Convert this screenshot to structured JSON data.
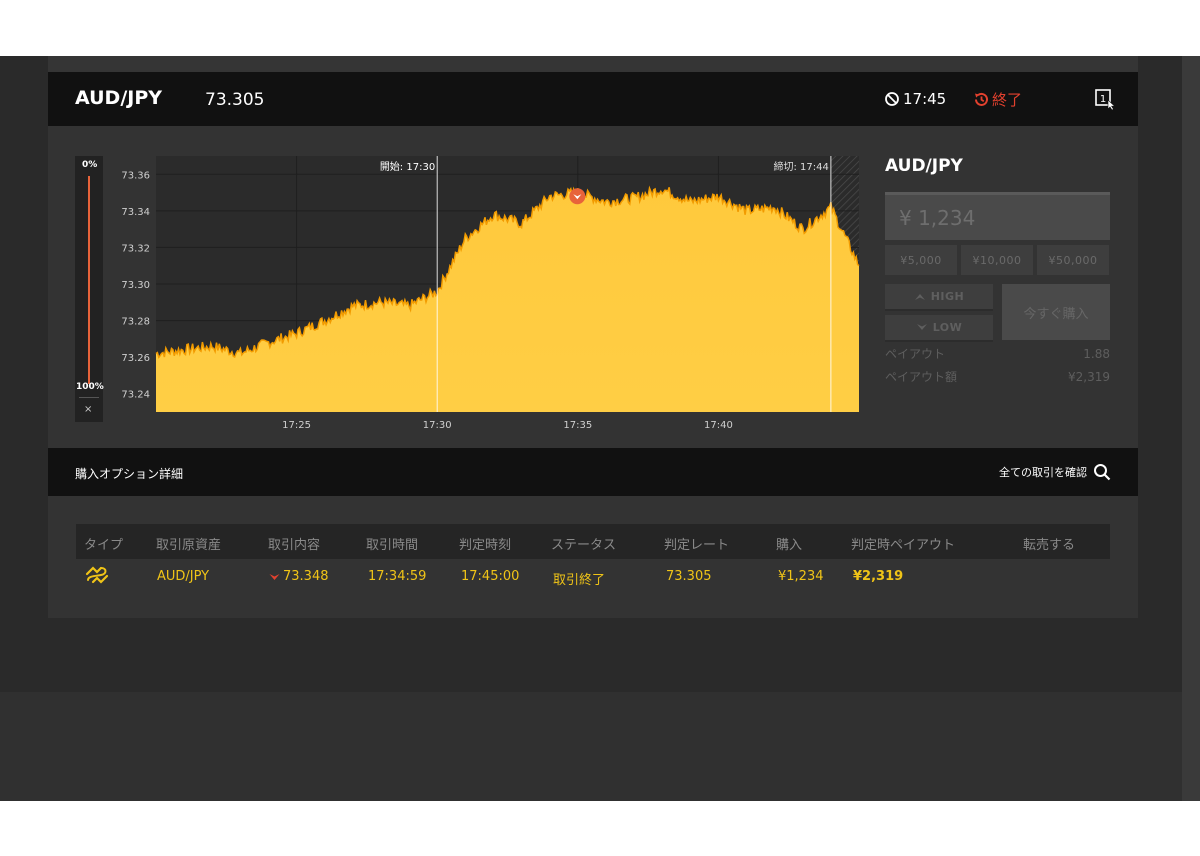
{
  "header": {
    "pair": "AUD/JPY",
    "rate": "73.305",
    "time": "17:45",
    "status": "終了"
  },
  "gauge": {
    "top": "0%",
    "bottom": "100%",
    "close": "×"
  },
  "chart_data": {
    "type": "area",
    "start_marker": "開始: 17:30",
    "close_marker": "締切: 17:44",
    "start_time": "17:30",
    "close_time": "17:44",
    "entry_time": "17:34:59",
    "entry_rate": 73.348,
    "x_ticks": [
      "17:25",
      "17:30",
      "17:35",
      "17:40"
    ],
    "y_ticks": [
      "73.36",
      "73.34",
      "73.32",
      "73.30",
      "73.28",
      "73.26",
      "73.24"
    ],
    "ylim": [
      73.23,
      73.37
    ],
    "xlim_min": [
      1040,
      1065
    ],
    "x": [
      1040,
      1041,
      1042,
      1043,
      1044,
      1045,
      1046,
      1047,
      1048,
      1049,
      1050,
      1051,
      1052,
      1053,
      1054,
      1055,
      1056,
      1057,
      1058,
      1059,
      1060,
      1061,
      1062,
      1063,
      1064,
      1065
    ],
    "y": [
      73.262,
      73.264,
      73.266,
      73.262,
      73.268,
      73.273,
      73.28,
      73.288,
      73.29,
      73.288,
      73.296,
      73.325,
      73.338,
      73.333,
      73.348,
      73.35,
      73.345,
      73.347,
      73.352,
      73.345,
      73.348,
      73.34,
      73.342,
      73.33,
      73.342,
      73.31
    ],
    "grid": true,
    "area_color": "#ffc93c",
    "line_color": "#f29b00"
  },
  "ticket": {
    "pair": "AUD/JPY",
    "amount": "¥ 1,234",
    "presets": [
      "¥5,000",
      "¥10,000",
      "¥50,000"
    ],
    "high_label": "HIGH",
    "low_label": "LOW",
    "buy_now": "今すぐ購入",
    "payout_label": "ペイアウト",
    "payout_value": "1.88",
    "payout_amount_label": "ペイアウト額",
    "payout_amount_value": "¥2,319"
  },
  "details": {
    "title": "購入オプション詳細",
    "confirm_all": "全ての取引を確認"
  },
  "table": {
    "headers": [
      "タイプ",
      "取引原資産",
      "取引内容",
      "取引時間",
      "判定時刻",
      "ステータス",
      "判定レート",
      "購入",
      "判定時ペイアウト",
      "転売する"
    ],
    "row": {
      "asset": "AUD/JPY",
      "content": "73.348",
      "trade_time": "17:34:59",
      "judge_time": "17:45:00",
      "status": "取引終了",
      "judge_rate": "73.305",
      "purchase": "¥1,234",
      "payout": "¥2,319"
    }
  },
  "colors": {
    "accent_yellow": "#f0c417",
    "danger_red": "#e3412e",
    "chart_area": "#ffc93c"
  }
}
